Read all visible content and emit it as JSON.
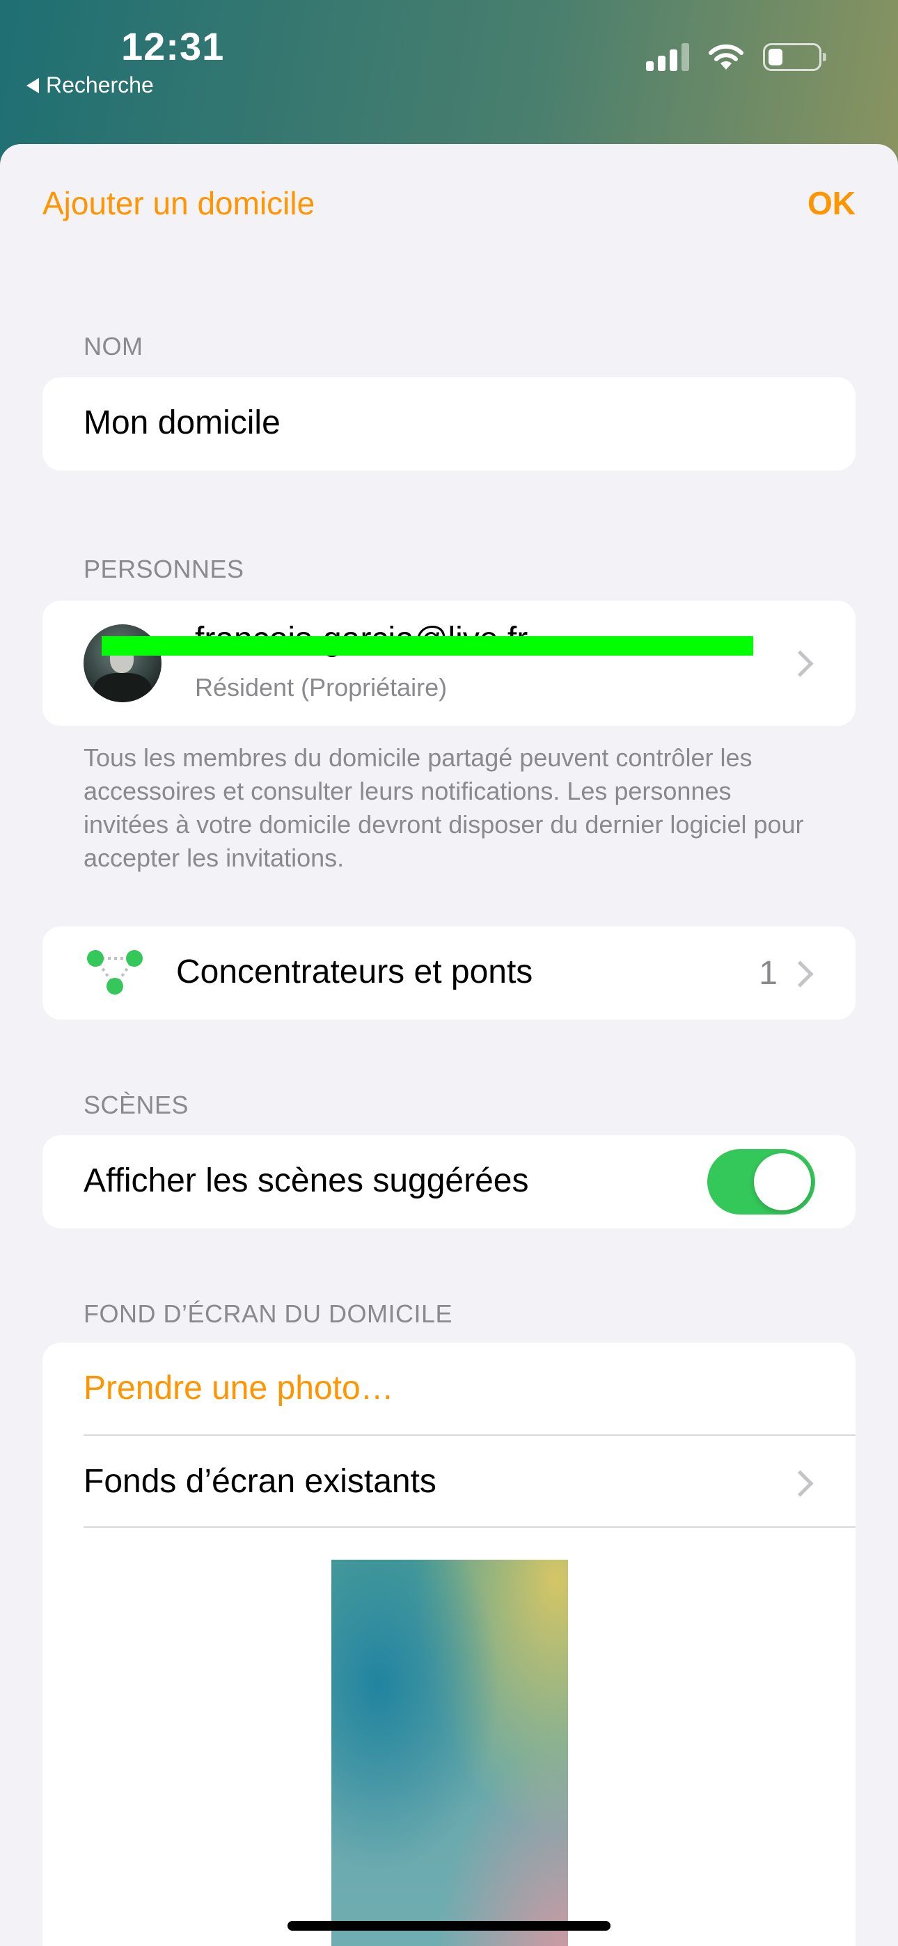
{
  "status_bar": {
    "time": "12:31",
    "back_label": "Recherche",
    "icons": [
      "cellular-signal-icon",
      "wifi-icon",
      "battery-icon"
    ]
  },
  "nav": {
    "left": "Ajouter un domicile",
    "right": "OK"
  },
  "name_section": {
    "header": "NOM",
    "value": "Mon domicile"
  },
  "people_section": {
    "header": "PERSONNES",
    "person": {
      "email": "francois-garcia@live.fr",
      "role": "Résident (Propriétaire)"
    },
    "footer": "Tous les membres du domicile partagé peuvent contrôler les accessoires et consulter leurs notifications. Les personnes invitées à votre domicile devront disposer du dernier logiciel pour accepter les invitations."
  },
  "hubs": {
    "label": "Concentrateurs et ponts",
    "count": "1"
  },
  "scenes_section": {
    "header": "SCÈNES",
    "toggle_label": "Afficher les scènes suggérées",
    "toggle_on": true
  },
  "wallpaper_section": {
    "header": "FOND D’ÉCRAN DU DOMICILE",
    "take_photo": "Prendre une photo…",
    "existing": "Fonds d’écran existants"
  },
  "colors": {
    "accent": "#ff9500",
    "toggle_on": "#34c759",
    "background": "#f2f2f7",
    "secondary_text": "#8a8a8e"
  }
}
